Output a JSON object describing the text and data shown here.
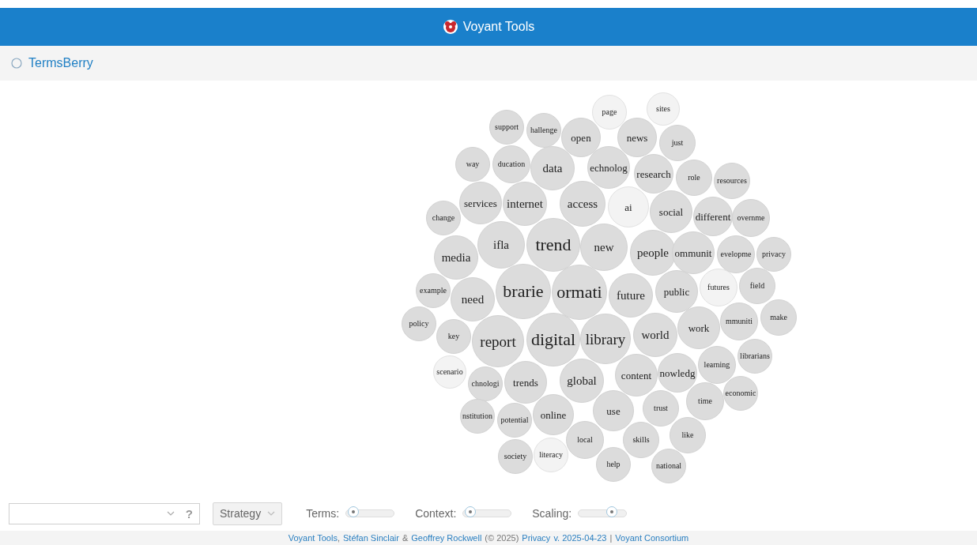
{
  "header": {
    "title": "Voyant Tools"
  },
  "panel": {
    "title": "TermsBerry"
  },
  "terms": [
    {
      "text": "page",
      "faded": true
    },
    {
      "text": "sites",
      "faded": true
    },
    {
      "text": "support",
      "faded": false
    },
    {
      "text": "hallenge",
      "faded": false
    },
    {
      "text": "open",
      "faded": false
    },
    {
      "text": "news",
      "faded": false
    },
    {
      "text": "just",
      "faded": false
    },
    {
      "text": "way",
      "faded": false
    },
    {
      "text": "ducation",
      "faded": false
    },
    {
      "text": "data",
      "faded": false
    },
    {
      "text": "echnolog",
      "faded": false
    },
    {
      "text": "research",
      "faded": false
    },
    {
      "text": "role",
      "faded": false
    },
    {
      "text": "resources",
      "faded": false
    },
    {
      "text": "change",
      "faded": false
    },
    {
      "text": "services",
      "faded": false
    },
    {
      "text": "internet",
      "faded": false
    },
    {
      "text": "access",
      "faded": false
    },
    {
      "text": "ai",
      "faded": true
    },
    {
      "text": "social",
      "faded": false
    },
    {
      "text": "different",
      "faded": false
    },
    {
      "text": "overnme",
      "faded": false
    },
    {
      "text": "media",
      "faded": false
    },
    {
      "text": "ifla",
      "faded": false
    },
    {
      "text": "trend",
      "faded": false
    },
    {
      "text": "new",
      "faded": false
    },
    {
      "text": "people",
      "faded": false
    },
    {
      "text": "ommunit",
      "faded": false
    },
    {
      "text": "evelopme",
      "faded": false
    },
    {
      "text": "privacy",
      "faded": false
    },
    {
      "text": "example",
      "faded": false
    },
    {
      "text": "need",
      "faded": false
    },
    {
      "text": "brarie",
      "faded": false
    },
    {
      "text": "ormati",
      "faded": false
    },
    {
      "text": "future",
      "faded": false
    },
    {
      "text": "public",
      "faded": false
    },
    {
      "text": "futures",
      "faded": true
    },
    {
      "text": "field",
      "faded": false
    },
    {
      "text": "policy",
      "faded": false
    },
    {
      "text": "key",
      "faded": false
    },
    {
      "text": "report",
      "faded": false
    },
    {
      "text": "digital",
      "faded": false
    },
    {
      "text": "library",
      "faded": false
    },
    {
      "text": "world",
      "faded": false
    },
    {
      "text": "work",
      "faded": false
    },
    {
      "text": "mmuniti",
      "faded": false
    },
    {
      "text": "make",
      "faded": false
    },
    {
      "text": "librarians",
      "faded": false
    },
    {
      "text": "scenario",
      "faded": true
    },
    {
      "text": "chnologi",
      "faded": false
    },
    {
      "text": "trends",
      "faded": false
    },
    {
      "text": "global",
      "faded": false
    },
    {
      "text": "content",
      "faded": false
    },
    {
      "text": "nowledg",
      "faded": false
    },
    {
      "text": "learning",
      "faded": false
    },
    {
      "text": "economic",
      "faded": false
    },
    {
      "text": "time",
      "faded": false
    },
    {
      "text": "trust",
      "faded": false
    },
    {
      "text": "nstitution",
      "faded": false
    },
    {
      "text": "potential",
      "faded": false
    },
    {
      "text": "online",
      "faded": false
    },
    {
      "text": "use",
      "faded": false
    },
    {
      "text": "local",
      "faded": false
    },
    {
      "text": "skills",
      "faded": false
    },
    {
      "text": "like",
      "faded": false
    },
    {
      "text": "society",
      "faded": false
    },
    {
      "text": "literacy",
      "faded": true
    },
    {
      "text": "help",
      "faded": false
    },
    {
      "text": "national",
      "faded": false
    }
  ],
  "toolbar": {
    "strategy": "Strategy",
    "help": "?",
    "sliders": [
      {
        "label": "Terms:",
        "level": 0.15
      },
      {
        "label": "Context:",
        "level": 0.15
      },
      {
        "label": "Scaling:",
        "level": 0.7
      }
    ]
  },
  "footer": [
    {
      "text": "Voyant Tools",
      "link": true
    },
    {
      "text": ",",
      "link": false
    },
    {
      "text": "Stéfan Sinclair",
      "link": true
    },
    {
      "text": "&",
      "link": false
    },
    {
      "text": "Geoffrey Rockwell",
      "link": true
    },
    {
      "text": "(© 2025)",
      "link": false
    },
    {
      "text": "Privacy",
      "link": true
    },
    {
      "text": "v. 2025-04-23",
      "link": true
    },
    {
      "text": "|",
      "link": false
    },
    {
      "text": "Voyant Consortium",
      "link": true
    }
  ]
}
